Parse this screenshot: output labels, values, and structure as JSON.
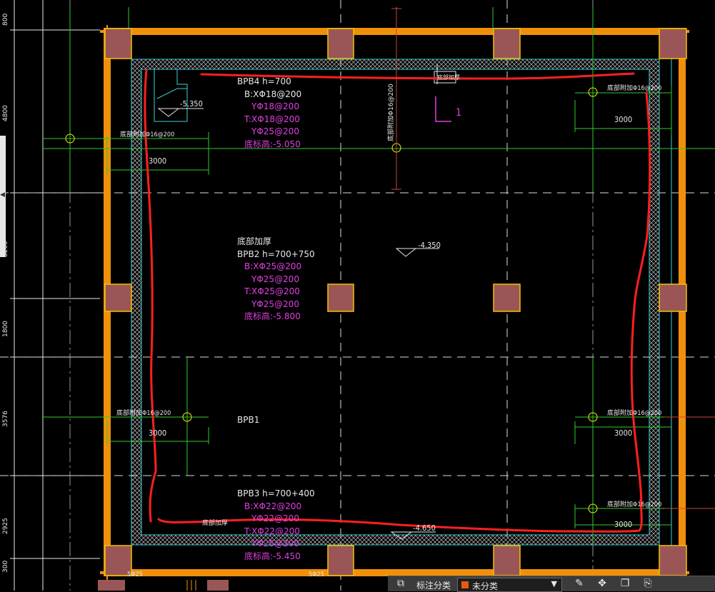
{
  "drawing": {
    "slab_labels": [
      {
        "key": "bpb4",
        "lines": [
          {
            "text": "BPB4 h=700",
            "color": "w"
          },
          {
            "text": "B:XΦ18@200",
            "color": "w"
          },
          {
            "text": "YΦ18@200",
            "color": "m"
          },
          {
            "text": "T:XΦ18@200",
            "color": "m"
          },
          {
            "text": "YΦ25@200",
            "color": "m"
          },
          {
            "text": "底标高:-5.050",
            "color": "m"
          }
        ]
      },
      {
        "key": "bpb2",
        "lines": [
          {
            "text": "底部加厚",
            "color": "w"
          },
          {
            "text": "BPB2  h=700+750",
            "color": "w"
          },
          {
            "text": "B:XΦ25@200",
            "color": "m"
          },
          {
            "text": "YΦ25@200",
            "color": "m"
          },
          {
            "text": "T:XΦ25@200",
            "color": "m"
          },
          {
            "text": "YΦ25@200",
            "color": "m"
          },
          {
            "text": "底标高:-5.800",
            "color": "m"
          }
        ]
      },
      {
        "key": "bpb1",
        "lines": [
          {
            "text": "BPB1",
            "color": "w"
          }
        ]
      },
      {
        "key": "bpb3",
        "lines": [
          {
            "text": "BPB3  h=700+400",
            "color": "w"
          },
          {
            "text": "B:XΦ22@200",
            "color": "m"
          },
          {
            "text": "YΦ22@200",
            "color": "m"
          },
          {
            "text": "T:XΦ22@200",
            "color": "m"
          },
          {
            "text": "YΦ25@200",
            "color": "m"
          },
          {
            "text": "底标高:-5.450",
            "color": "m"
          }
        ]
      }
    ],
    "elevations": {
      "e1": "-5.350",
      "e2": "-4.350",
      "e3": "-4.650"
    },
    "extra_rebar": {
      "left_top": "底部附加Φ16@200",
      "right_top": "底部附加Φ16@200",
      "left_mid": "底部附加Φ16@200",
      "right_mid": "底部附加Φ16@200",
      "right_bot": "底部附加Φ16@200",
      "top_vertical": "底部附加Φ16@200",
      "thicken_bottom": "底部加厚"
    },
    "rebar_lengths": {
      "left_top": "3000",
      "right_top": "3000",
      "left_mid": "3000",
      "right_mid": "3000",
      "right_bot": "3000"
    },
    "section_mark": "1",
    "section_label": "底部加厚",
    "row_dims": [
      "800",
      "4800",
      "3200",
      "1800",
      "3576",
      "2925",
      "300"
    ],
    "bottom_marks": {
      "left": "5Φ25",
      "mid": "5Φ25"
    },
    "colors": {
      "wall": "#f0900a",
      "column": "#9a5656",
      "column_border": "#f5c000",
      "grid": "#2ecc2e",
      "cloud": "#ff2020",
      "magenta": "#e040e0",
      "cyan": "#3ccfd8"
    }
  },
  "toolbar": {
    "label": "标注分类",
    "selected": "未分类",
    "icons": [
      "layers-icon",
      "annotate-icon",
      "move-icon",
      "copy-icon",
      "paste-icon"
    ]
  }
}
